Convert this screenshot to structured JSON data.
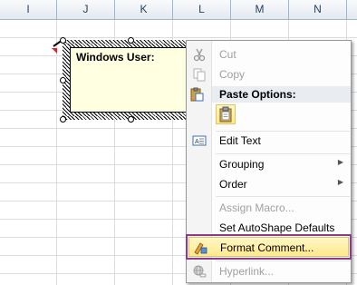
{
  "spreadsheet": {
    "columns": [
      "I",
      "J",
      "K",
      "L",
      "M",
      "N"
    ]
  },
  "comment": {
    "author": "Windows User:"
  },
  "context_menu": {
    "paste_options_header": "Paste Options:",
    "items": [
      {
        "label": "Cut",
        "enabled": false,
        "icon": "scissors-icon"
      },
      {
        "label": "Copy",
        "enabled": false,
        "icon": "copy-icon"
      },
      {
        "label": "Edit Text",
        "enabled": true,
        "icon": "edit-text-icon"
      },
      {
        "label": "Grouping",
        "enabled": true,
        "submenu": true
      },
      {
        "label": "Order",
        "enabled": true,
        "submenu": true
      },
      {
        "label": "Assign Macro...",
        "enabled": false
      },
      {
        "label": "Set AutoShape Defaults",
        "enabled": true
      },
      {
        "label": "Format Comment...",
        "enabled": true,
        "highlighted": true,
        "icon": "format-comment-icon"
      },
      {
        "label": "Hyperlink...",
        "enabled": false,
        "icon": "hyperlink-icon"
      }
    ]
  },
  "colors": {
    "highlight_outline": "#8a3b8f",
    "comment_background": "#ffffe1",
    "comment_indicator": "#e02020"
  }
}
